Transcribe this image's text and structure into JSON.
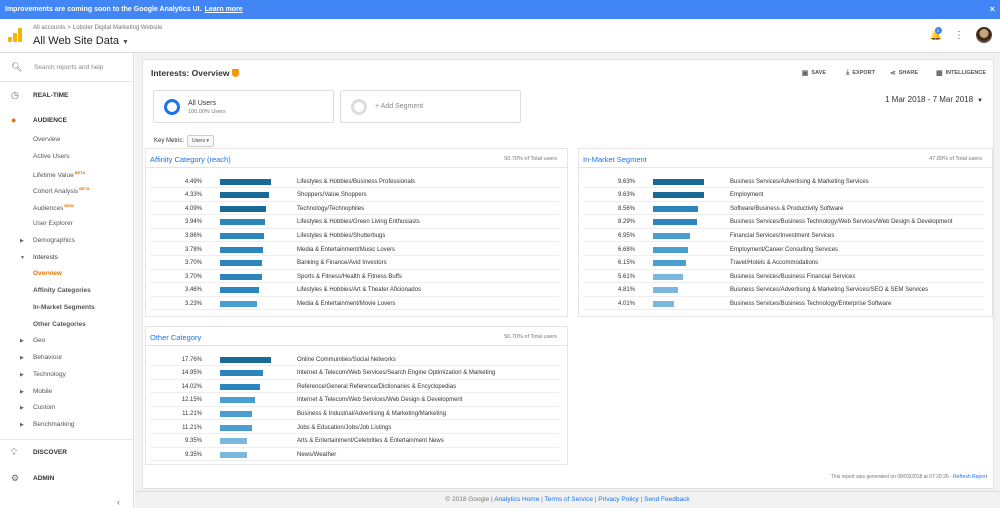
{
  "banner": {
    "text": "Improvements are coming soon to the Google Analytics UI.",
    "link": "Learn more",
    "close": "×"
  },
  "header": {
    "crumb_all": "All accounts",
    "crumb_sep": ">",
    "crumb_account": "Lobster Digital Marketing Website",
    "view": "All Web Site Data",
    "notif_count": "2",
    "icons": {
      "logo": "analytics-logo-icon",
      "bell": "bell-icon",
      "more": "more-vertical-icon"
    }
  },
  "sidebar": {
    "search_placeholder": "Search reports and help",
    "realtime": "REAL-TIME",
    "audience": "AUDIENCE",
    "items": {
      "overview": "Overview",
      "active_users": "Active Users",
      "lifetime_value": "Lifetime Value",
      "cohort": "Cohort Analysis",
      "audiences": "Audiences",
      "user_explorer": "User Explorer",
      "demographics": "Demographics",
      "interests": "Interests",
      "interests_overview": "Overview",
      "affinity": "Affinity Categories",
      "in_market": "In-Market Segments",
      "other_cat": "Other Categories",
      "geo": "Geo",
      "behaviour": "Behaviour",
      "technology": "Technology",
      "mobile": "Mobile",
      "custom": "Custom",
      "benchmarking": "Benchmarking"
    },
    "beta": "BETA",
    "new": "NEW",
    "discover": "DISCOVER",
    "admin": "ADMIN"
  },
  "report": {
    "title": "Interests: Overview",
    "toolbar": {
      "save": "SAVE",
      "export": "EXPORT",
      "share": "SHARE",
      "intelligence": "INTELLIGENCE"
    },
    "segment_all": {
      "name": "All Users",
      "pct": "100.00% Users"
    },
    "segment_add": "+ Add Segment",
    "date_range": "1 Mar 2018 - 7 Mar 2018",
    "key_metric_label": "Key Metric:",
    "key_metric_value": "Users",
    "generated": "This report was generated on 08/03/2018 at 07:20:26 -",
    "refresh": "Refresh Report"
  },
  "affinity": {
    "title": "Affinity Category (reach)",
    "total": "50.70% of Total users",
    "rows": [
      {
        "pct": "4.49%",
        "value": 4.49,
        "name": "Lifestyles & Hobbies/Business Professionals"
      },
      {
        "pct": "4.33%",
        "value": 4.33,
        "name": "Shoppers/Value Shoppers"
      },
      {
        "pct": "4.09%",
        "value": 4.09,
        "name": "Technology/Technophiles"
      },
      {
        "pct": "3.94%",
        "value": 3.94,
        "name": "Lifestyles & Hobbies/Green Living Enthusiasts"
      },
      {
        "pct": "3.86%",
        "value": 3.86,
        "name": "Lifestyles & Hobbies/Shutterbugs"
      },
      {
        "pct": "3.78%",
        "value": 3.78,
        "name": "Media & Entertainment/Music Lovers"
      },
      {
        "pct": "3.70%",
        "value": 3.7,
        "name": "Banking & Finance/Avid Investors"
      },
      {
        "pct": "3.70%",
        "value": 3.7,
        "name": "Sports & Fitness/Health & Fitness Buffs"
      },
      {
        "pct": "3.46%",
        "value": 3.46,
        "name": "Lifestyles & Hobbies/Art & Theater Aficionados"
      },
      {
        "pct": "3.23%",
        "value": 3.23,
        "name": "Media & Entertainment/Movie Lovers"
      }
    ]
  },
  "in_market": {
    "title": "In-Market Segment",
    "total": "47.89% of Total users",
    "rows": [
      {
        "pct": "9.63%",
        "value": 9.63,
        "name": "Business Services/Advertising & Marketing Services"
      },
      {
        "pct": "9.63%",
        "value": 9.63,
        "name": "Employment"
      },
      {
        "pct": "8.56%",
        "value": 8.56,
        "name": "Software/Business & Productivity Software"
      },
      {
        "pct": "8.29%",
        "value": 8.29,
        "name": "Business Services/Business Technology/Web Services/Web Design & Development"
      },
      {
        "pct": "6.95%",
        "value": 6.95,
        "name": "Financial Services/Investment Services"
      },
      {
        "pct": "6.68%",
        "value": 6.68,
        "name": "Employment/Career Consulting Services"
      },
      {
        "pct": "6.15%",
        "value": 6.15,
        "name": "Travel/Hotels & Accommodations"
      },
      {
        "pct": "5.61%",
        "value": 5.61,
        "name": "Business Services/Business Financial Services"
      },
      {
        "pct": "4.81%",
        "value": 4.81,
        "name": "Business Services/Advertising & Marketing Services/SEO & SEM Services"
      },
      {
        "pct": "4.01%",
        "value": 4.01,
        "name": "Business Services/Business Technology/Enterprise Software"
      }
    ]
  },
  "other": {
    "title": "Other Category",
    "total": "50.70% of Total users",
    "rows": [
      {
        "pct": "17.76%",
        "value": 17.76,
        "name": "Online Communities/Social Networks"
      },
      {
        "pct": "14.95%",
        "value": 14.95,
        "name": "Internet & Telecom/Web Services/Search Engine Optimization & Marketing"
      },
      {
        "pct": "14.02%",
        "value": 14.02,
        "name": "Reference/General Reference/Dictionaries & Encyclopedias"
      },
      {
        "pct": "12.15%",
        "value": 12.15,
        "name": "Internet & Telecom/Web Services/Web Design & Development"
      },
      {
        "pct": "11.21%",
        "value": 11.21,
        "name": "Business & Industrial/Advertising & Marketing/Marketing"
      },
      {
        "pct": "11.21%",
        "value": 11.21,
        "name": "Jobs & Education/Jobs/Job Listings"
      },
      {
        "pct": "9.35%",
        "value": 9.35,
        "name": "Arts & Entertainment/Celebrities & Entertainment News"
      },
      {
        "pct": "9.35%",
        "value": 9.35,
        "name": "News/Weather"
      }
    ]
  },
  "footer": {
    "copyright": "© 2018 Google |",
    "links": [
      "Analytics Home",
      "Terms of Service",
      "Privacy Policy",
      "Send Feedback"
    ]
  },
  "colors": {
    "banner": "#4285f4",
    "accent": "#e37400",
    "bar_dark": "#1a6a98",
    "bar_light": "#7ab8dd",
    "link": "#1a73e8"
  }
}
